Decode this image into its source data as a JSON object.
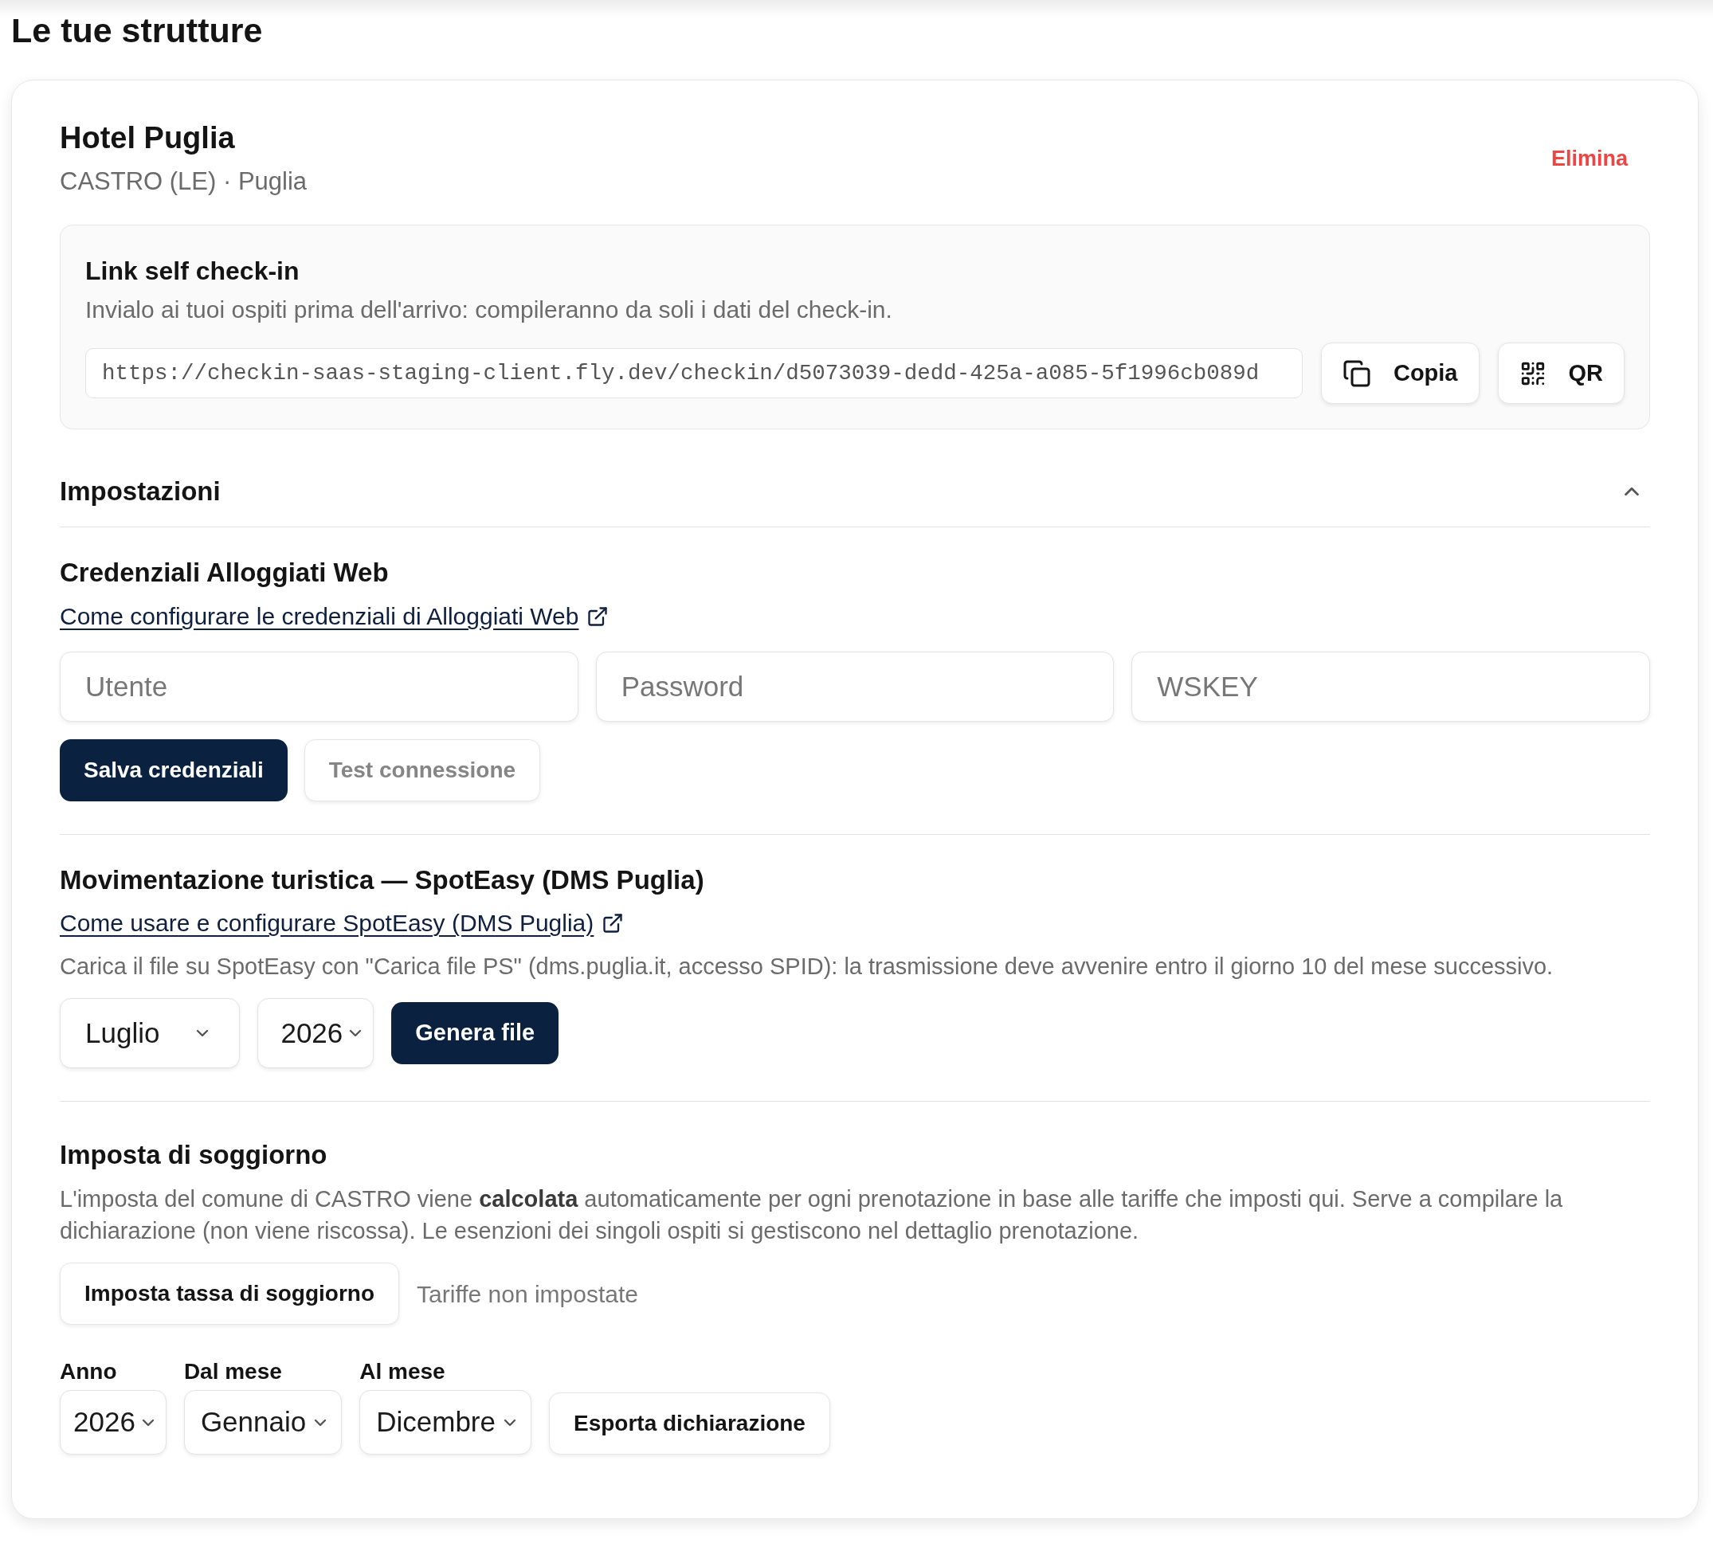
{
  "page": {
    "title": "Le tue strutture"
  },
  "property": {
    "name": "Hotel Puglia",
    "location": "CASTRO (LE) · Puglia",
    "delete_action": "Elimina"
  },
  "self_checkin": {
    "title": "Link self check-in",
    "description": "Invialo ai tuoi ospiti prima dell'arrivo: compileranno da soli i dati del check-in.",
    "url": "https://checkin-saas-staging-client.fly.dev/checkin/d5073039-dedd-425a-a085-5f1996cb089d",
    "actions": [
      {
        "kind": "copy",
        "label": "Copia"
      },
      {
        "kind": "qr",
        "label": "QR"
      }
    ]
  },
  "settings": {
    "title": "Impostazioni",
    "expanded": true,
    "alloggiati_web": {
      "title": "Credenziali Alloggiati Web",
      "help_link": "Come configurare le credenziali di Alloggiati Web",
      "fields": [
        {
          "placeholder": "Utente"
        },
        {
          "placeholder": "Password"
        },
        {
          "placeholder": "WSKEY"
        }
      ],
      "buttons": [
        {
          "kind": "primary",
          "label": "Salva credenziali",
          "disabled": false
        },
        {
          "kind": "outline",
          "label": "Test connessione",
          "disabled": true
        }
      ]
    },
    "spoteasy": {
      "title": "Movimentazione turistica — SpotEasy (DMS Puglia)",
      "help_link": "Come usare e configurare SpotEasy (DMS Puglia)",
      "description": "Carica il file su SpotEasy con \"Carica file PS\" (dms.puglia.it, accesso SPID): la trasmissione deve avvenire entro il giorno 10 del mese successivo.",
      "month": {
        "value": "Luglio"
      },
      "year": {
        "value": "2026"
      },
      "generate_button": "Genera file"
    },
    "tourist_tax": {
      "title": "Imposta di soggiorno",
      "description": "L'imposta del comune di CASTRO viene **calcolata** automaticamente per ogni prenotazione in base alle tariffe che imposti qui. Serve a compilare la dichiarazione (non viene riscossa). Le esenzioni dei singoli ospiti si gestiscono nel dettaglio prenotazione.",
      "setup_button": "Imposta tassa di soggiorno",
      "rates_status": "Tariffe non impostate",
      "filters": [
        {
          "label": "Anno",
          "value": "2026"
        },
        {
          "label": "Dal mese",
          "value": "Gennaio"
        },
        {
          "label": "Al mese",
          "value": "Dicembre"
        }
      ],
      "export_button": "Esporta dichiarazione"
    }
  }
}
